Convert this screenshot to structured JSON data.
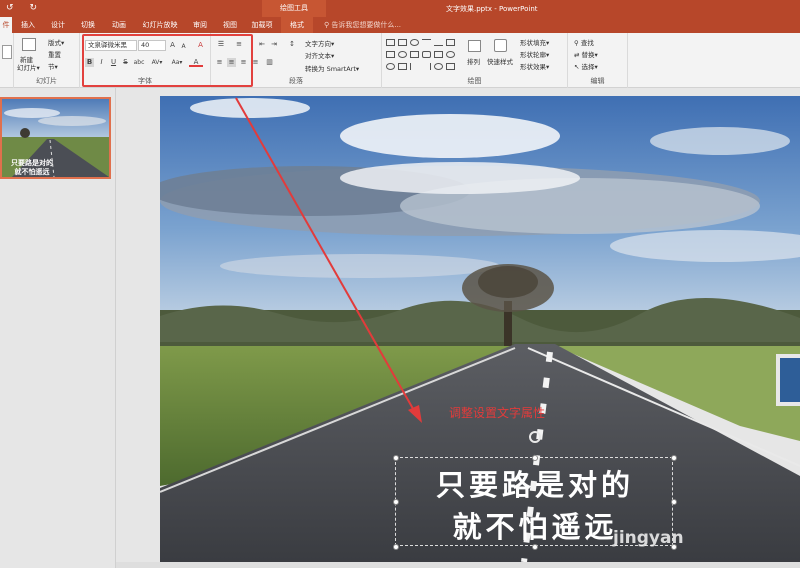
{
  "titlebar": {
    "qat_undo": "↺",
    "qat_redo": "↻",
    "tools_label": "绘图工具",
    "doc_title": "文字效果.pptx - PowerPoint"
  },
  "tabs": [
    {
      "label": "件"
    },
    {
      "label": "插入"
    },
    {
      "label": "设计"
    },
    {
      "label": "切换"
    },
    {
      "label": "动画"
    },
    {
      "label": "幻灯片放映"
    },
    {
      "label": "审阅"
    },
    {
      "label": "视图"
    },
    {
      "label": "加载项"
    },
    {
      "label": "格式"
    }
  ],
  "search": {
    "label": "告诉我您想要做什么..."
  },
  "ribbon": {
    "slides": {
      "new_slide_l1": "新建",
      "new_slide_l2": "幻灯片▾",
      "layout": "版式▾",
      "reset": "重置",
      "section": "节▾",
      "label": "幻灯片"
    },
    "font": {
      "font_name": "文泉驿微米黑",
      "font_size": "40",
      "bold": "B",
      "italic": "I",
      "underline": "U",
      "strike": "S",
      "shadow": "abc",
      "spacing": "AV▾",
      "case": "Aa▾",
      "grow": "A",
      "shrink": "A",
      "clear": "A",
      "label": "字体"
    },
    "paragraph": {
      "text_direction": "文字方向▾",
      "align_text": "对齐文本▾",
      "smartart": "转换为 SmartArt▾",
      "label": "段落"
    },
    "drawing": {
      "arrange": "排列",
      "quick_styles": "快速样式",
      "fill": "形状填充▾",
      "outline": "形状轮廓▾",
      "effects": "形状效果▾",
      "label": "绘图"
    },
    "editing": {
      "find": "查找",
      "replace": "替换▾",
      "select": "选择▾",
      "label": "编辑"
    }
  },
  "thumbnail": {
    "line1": "只要路是对的",
    "line2": "就不怕遥远"
  },
  "slide": {
    "annotation": "调整设置文字属性",
    "line1": "只要路是对的",
    "line2": "就不怕遥远",
    "watermark": "jingyan"
  }
}
